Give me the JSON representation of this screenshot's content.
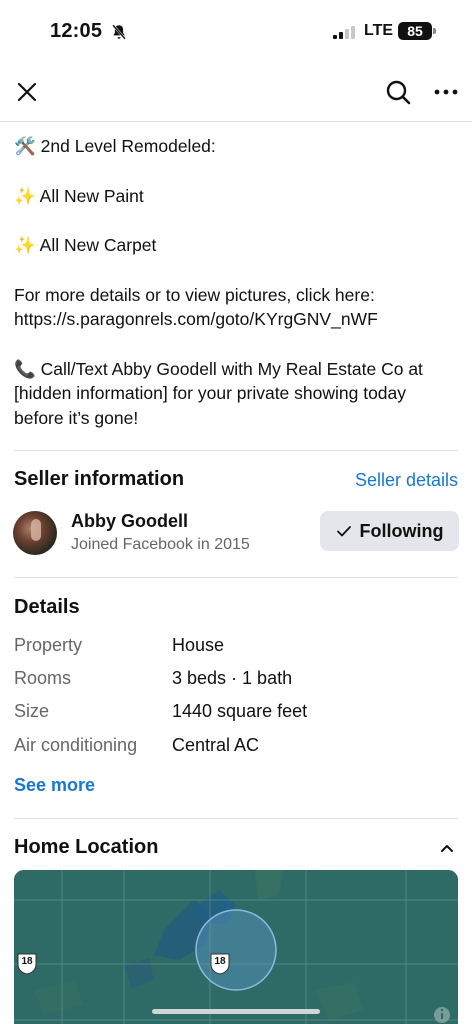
{
  "status_bar": {
    "time": "12:05",
    "network": "LTE",
    "battery": "85"
  },
  "navbar": {
    "close_icon": "close-icon",
    "search_icon": "search-icon",
    "more_icon": "more-dots-icon"
  },
  "description": {
    "lines": [
      "🛠️ 2nd Level Remodeled:",
      "✨ All New Paint",
      "✨ All New Carpet",
      "For more details or to view pictures, click here: https://s.paragonrels.com/goto/KYrgGNV_nWF",
      "📞 Call/Text Abby Goodell with My Real Estate Co at [hidden information] for your private showing today before it’s gone!"
    ]
  },
  "seller": {
    "section_title": "Seller information",
    "details_link": "Seller details",
    "name": "Abby Goodell",
    "joined": "Joined Facebook in 2015",
    "follow_label": "Following"
  },
  "details": {
    "section_title": "Details",
    "rows": [
      {
        "key": "Property",
        "value": "House"
      },
      {
        "key": "Rooms",
        "value": "3 beds · 1 bath"
      },
      {
        "key": "Size",
        "value": "1440 square feet"
      },
      {
        "key": "Air conditioning",
        "value": "Central AC"
      }
    ],
    "see_more": "See more"
  },
  "location": {
    "section_title": "Home Location",
    "route_shield": "18",
    "colors": {
      "map_bg": "#2e6a66",
      "water": "#1f5f86",
      "radius": "#5b97c7"
    }
  },
  "colors": {
    "link": "#1877d2",
    "button_bg": "#e4e6eb"
  }
}
